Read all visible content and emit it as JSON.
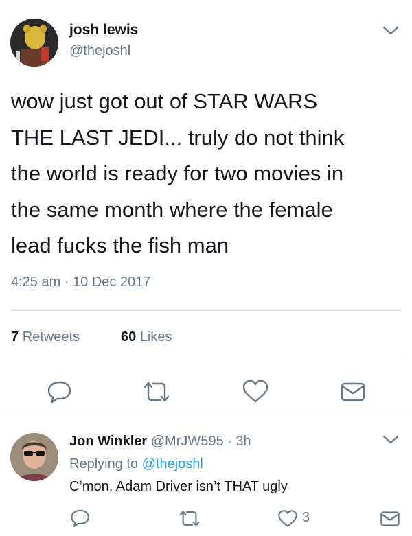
{
  "tweet": {
    "author_name": "josh lewis",
    "author_handle": "@thejoshl",
    "text_lines": [
      "wow just got out of STAR WARS",
      "THE LAST JEDI... truly do not think",
      "the world is ready for two movies in",
      "the same month where the female",
      "lead fucks the fish man"
    ],
    "timestamp": "4:25 am · 10 Dec 2017",
    "retweets_count": "7",
    "retweets_label": "Retweets",
    "likes_count": "60",
    "likes_label": "Likes"
  },
  "reply": {
    "author_name": "Jon Winkler",
    "author_handle": "@MrJW595",
    "separator": "·",
    "time": "3h",
    "replying_prefix": "Replying to",
    "replying_handle": "@thejoshl",
    "text": "C’mon, Adam Driver isn’t THAT ugly",
    "likes_count": "3"
  },
  "icons": {
    "menu": "chevron-down-icon",
    "reply": "reply-icon",
    "retweet": "retweet-icon",
    "like": "heart-icon",
    "message": "envelope-icon"
  },
  "colors": {
    "text": "#14171a",
    "secondary": "#657786",
    "link": "#1da1f2",
    "divider": "#e1e8ed"
  }
}
